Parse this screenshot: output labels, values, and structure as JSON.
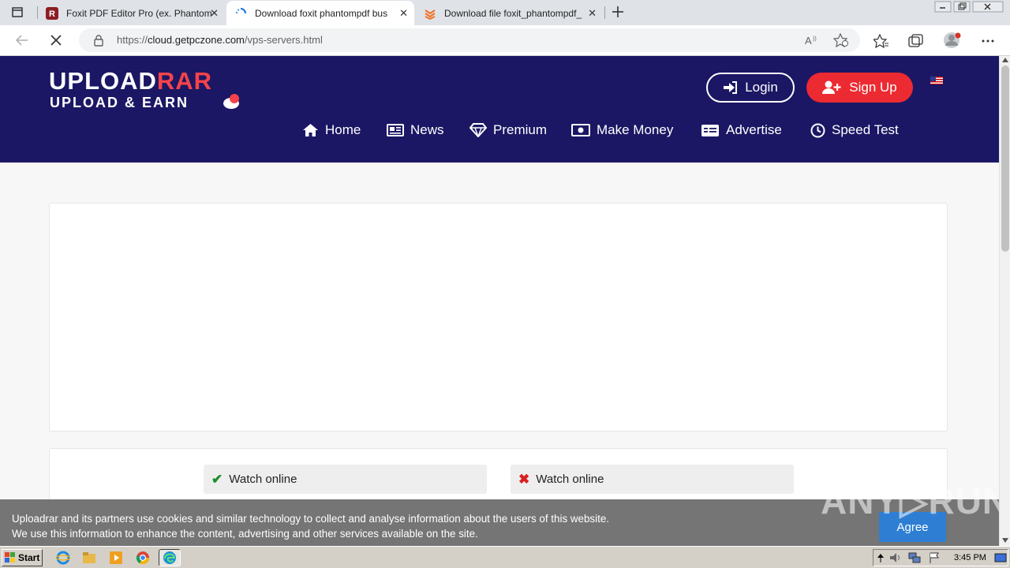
{
  "browser": {
    "tabs": [
      {
        "title": "Foxit PDF Editor Pro (ex. Phantom",
        "icon": "foxit-icon"
      },
      {
        "title": "Download foxit phantompdf bus",
        "icon": "loading-icon"
      },
      {
        "title": "Download file foxit_phantompdf_",
        "icon": "stack-icon"
      }
    ],
    "url_host": "cloud.getpczone.com",
    "url_prefix": "https://",
    "url_path": "/vps-servers.html"
  },
  "site": {
    "logo_upload": "UPL",
    "logo_o": "O",
    "logo_ad": "AD",
    "logo_rar": "RAR",
    "logo_sub": "UPLOAD & EARN",
    "login": "Login",
    "signup": "Sign Up",
    "nav": [
      {
        "label": "Home",
        "icon": "home-icon"
      },
      {
        "label": "News",
        "icon": "newspaper-icon"
      },
      {
        "label": "Premium",
        "icon": "diamond-icon"
      },
      {
        "label": "Make Money",
        "icon": "money-icon"
      },
      {
        "label": "Advertise",
        "icon": "ad-card-icon"
      },
      {
        "label": "Speed Test",
        "icon": "clock-icon"
      }
    ],
    "colors": {
      "header": "#1b1764",
      "accent": "#ec2a31"
    }
  },
  "content": {
    "watch_online_ok": "Watch online",
    "watch_online_fail": "Watch online"
  },
  "cookie": {
    "line1": "Uploadrar and its partners use cookies and similar technology to collect and analyse information about the users of this website.",
    "line2": "We use this information to enhance the content, advertising and other services available on the site.",
    "agree": "Agree"
  },
  "watermark": "ANY▷RUN",
  "taskbar": {
    "start": "Start",
    "clock": "3:45 PM"
  }
}
